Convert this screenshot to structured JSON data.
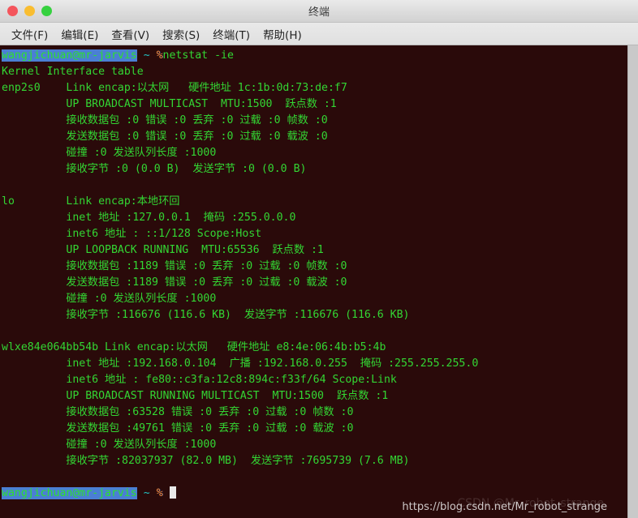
{
  "window": {
    "title": "终端",
    "buttons": {
      "close": "close",
      "minimize": "minimize",
      "maximize": "maximize"
    }
  },
  "menubar": {
    "items": [
      {
        "label": "文件(F)",
        "name": "menu-file"
      },
      {
        "label": "编辑(E)",
        "name": "menu-edit"
      },
      {
        "label": "查看(V)",
        "name": "menu-view"
      },
      {
        "label": "搜索(S)",
        "name": "menu-search"
      },
      {
        "label": "终端(T)",
        "name": "menu-terminal"
      },
      {
        "label": "帮助(H)",
        "name": "menu-help"
      }
    ]
  },
  "terminal": {
    "prompt": {
      "user_host": "wangjichuan@mr-jarvis",
      "path": "~",
      "sigil": "%"
    },
    "command": "netstat -ie",
    "lines": [
      "Kernel Interface table",
      "enp2s0    Link encap:以太网   硬件地址 1c:1b:0d:73:de:f7  ",
      "          UP BROADCAST MULTICAST  MTU:1500  跃点数 :1",
      "          接收数据包 :0 错误 :0 丢弃 :0 过载 :0 帧数 :0",
      "          发送数据包 :0 错误 :0 丢弃 :0 过载 :0 载波 :0",
      "          碰撞 :0 发送队列长度 :1000 ",
      "          接收字节 :0 (0.0 B)  发送字节 :0 (0.0 B)",
      "",
      "lo        Link encap:本地环回  ",
      "          inet 地址 :127.0.0.1  掩码 :255.0.0.0",
      "          inet6 地址 : ::1/128 Scope:Host",
      "          UP LOOPBACK RUNNING  MTU:65536  跃点数 :1",
      "          接收数据包 :1189 错误 :0 丢弃 :0 过载 :0 帧数 :0",
      "          发送数据包 :1189 错误 :0 丢弃 :0 过载 :0 载波 :0",
      "          碰撞 :0 发送队列长度 :1000 ",
      "          接收字节 :116676 (116.6 KB)  发送字节 :116676 (116.6 KB)",
      "",
      "wlxe84e064bb54b Link encap:以太网   硬件地址 e8:4e:06:4b:b5:4b  ",
      "          inet 地址 :192.168.0.104  广播 :192.168.0.255  掩码 :255.255.255.0",
      "          inet6 地址 : fe80::c3fa:12c8:894c:f33f/64 Scope:Link",
      "          UP BROADCAST RUNNING MULTICAST  MTU:1500  跃点数 :1",
      "          接收数据包 :63528 错误 :0 丢弃 :0 过载 :0 帧数 :0",
      "          发送数据包 :49761 错误 :0 丢弃 :0 过载 :0 载波 :0",
      "          碰撞 :0 发送队列长度 :1000 ",
      "          接收字节 :82037937 (82.0 MB)  发送字节 :7695739 (7.6 MB)",
      ""
    ]
  },
  "watermark": {
    "text": "https://blog.csdn.net/Mr_robot_strange",
    "ghost": "CSDN @Mr_robot_strange"
  },
  "colors": {
    "background": "#2a0a0a",
    "foreground": "#33d633",
    "prompt_highlight": "#4a7fd4",
    "path": "#23c4c4",
    "titlebar": "#dcdcdc"
  }
}
